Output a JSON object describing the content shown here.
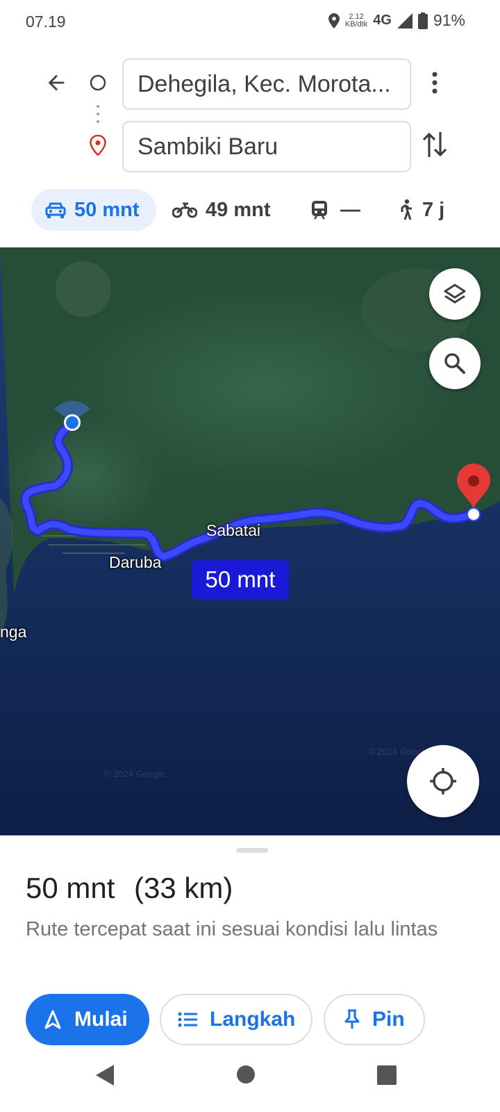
{
  "status_bar": {
    "time": "07.19",
    "speed_value": "2.12",
    "speed_unit": "KB/dtk",
    "network": "4G",
    "battery": "91%"
  },
  "search": {
    "origin": "Dehegila, Kec. Morota...",
    "destination": "Sambiki Baru"
  },
  "modes": [
    {
      "label": "50 mnt",
      "icon": "car-icon",
      "active": true
    },
    {
      "label": "49 mnt",
      "icon": "motorcycle-icon"
    },
    {
      "label": "—",
      "icon": "transit-icon"
    },
    {
      "label": "7 j",
      "icon": "walk-icon"
    }
  ],
  "map": {
    "labels": {
      "sabatai": "Sabatai",
      "daruba": "Daruba",
      "nga": "nga"
    },
    "route_eta": "50 mnt",
    "watermark": "© 2024 Google",
    "colors": {
      "route": "#2a3fff",
      "pin": "#e53935"
    }
  },
  "sheet": {
    "duration": "50 mnt",
    "distance": "(33 km)",
    "description": "Rute tercepat saat ini sesuai kondisi lalu lintas",
    "buttons": {
      "start": "Mulai",
      "steps": "Langkah",
      "pin": "Pin"
    }
  }
}
